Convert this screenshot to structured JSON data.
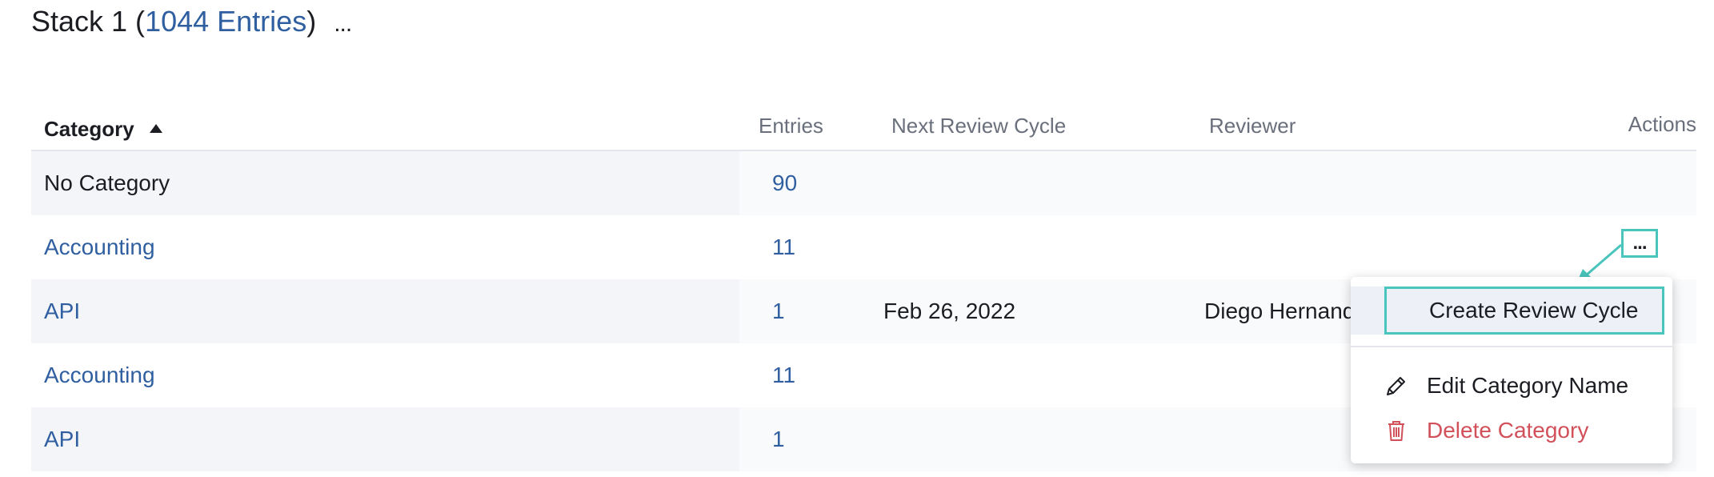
{
  "header": {
    "title_prefix": "Stack 1 (",
    "count_label": "1044 Entries",
    "title_suffix": ")",
    "more_label": "..."
  },
  "table": {
    "columns": {
      "category": "Category",
      "entries": "Entries",
      "next_review": "Next Review Cycle",
      "reviewer": "Reviewer",
      "actions": "Actions"
    },
    "rows": [
      {
        "category": "No Category",
        "entries": "90",
        "next_review": "",
        "reviewer": ""
      },
      {
        "category": "Accounting",
        "entries": "11",
        "next_review": "",
        "reviewer": ""
      },
      {
        "category": "API",
        "entries": "1",
        "next_review": "Feb 26, 2022",
        "reviewer": "Diego Hernand"
      },
      {
        "category": "Accounting",
        "entries": "11",
        "next_review": "",
        "reviewer": ""
      },
      {
        "category": "API",
        "entries": "1",
        "next_review": "",
        "reviewer": ""
      }
    ]
  },
  "actions": {
    "more_label": "..."
  },
  "menu": {
    "create_label": "Create Review Cycle",
    "edit_label": "Edit Category Name",
    "delete_label": "Delete Category"
  },
  "colors": {
    "link": "#2f5fa0",
    "highlight": "#49c5bd",
    "danger": "#d1505a"
  }
}
